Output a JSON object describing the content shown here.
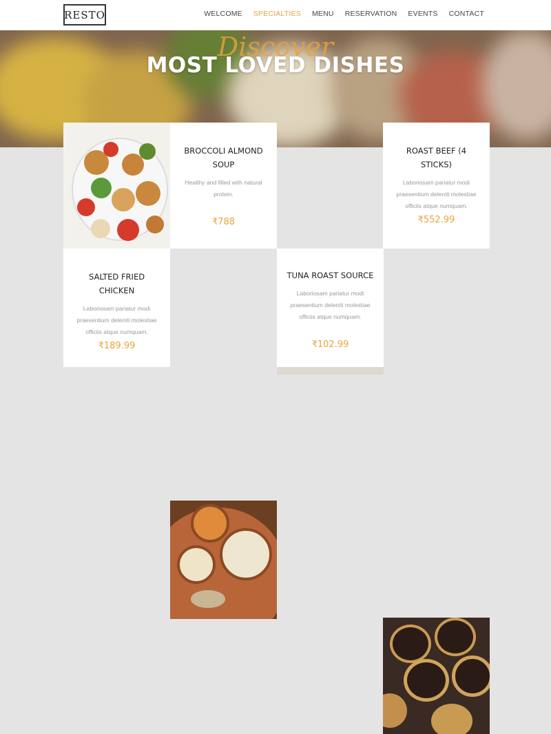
{
  "header": {
    "logo": "RESTO",
    "nav": [
      {
        "label": "WELCOME"
      },
      {
        "label": "SPECIALTIES"
      },
      {
        "label": "MENU"
      },
      {
        "label": "RESERVATION"
      },
      {
        "label": "EVENTS"
      },
      {
        "label": "CONTACT"
      }
    ],
    "active_nav": "SPECIALTIES"
  },
  "hero": {
    "script_text": "Discover",
    "title": "MOST LOVED DISHES"
  },
  "dishes": [
    {
      "name": "BROCCOLI ALMOND SOUP",
      "description": "Healthy and filled with natural protein.",
      "price": "₹788"
    },
    {
      "name": "ROAST BEEF (4 STICKS)",
      "description": "Laboriosam pariatur modi praesentium deleniti molestiae officiis atque numquam.",
      "price": "₹552.99"
    },
    {
      "name": "SALTED FRIED CHICKEN",
      "description": "Laboriosam pariatur modi praesentium deleniti molestiae officiis atque numquam.",
      "price": "₹189.99"
    },
    {
      "name": "TUNA ROAST SOURCE",
      "description": "Laboriosam pariatur modi praesentium deleniti molestiae officiis atque numquam.",
      "price": "₹102.99"
    }
  ],
  "colors": {
    "accent": "#e8a33c",
    "text": "#222222",
    "muted": "#999999"
  }
}
